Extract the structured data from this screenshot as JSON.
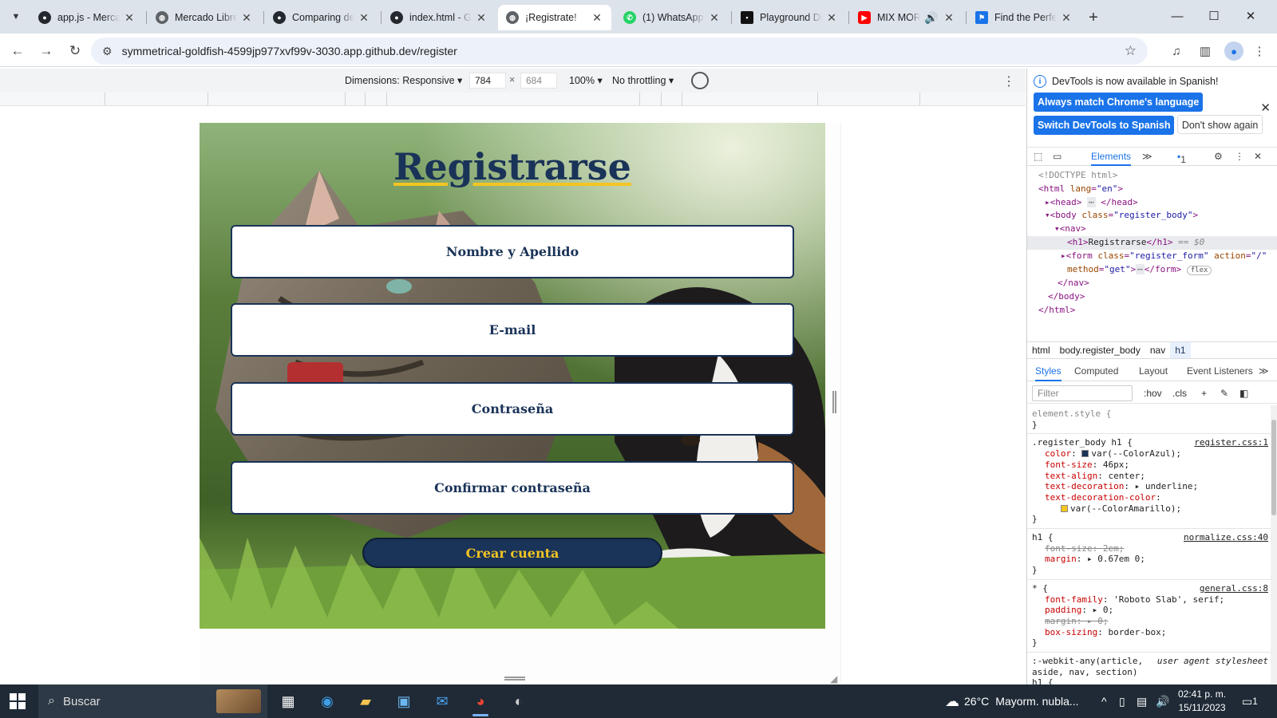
{
  "tabs": [
    {
      "title": "app.js - Mercado",
      "favicon": "github-icon",
      "active": false
    },
    {
      "title": "Mercado Libre",
      "favicon": "globe-icon",
      "active": false
    },
    {
      "title": "Comparing de",
      "favicon": "github-icon",
      "active": false
    },
    {
      "title": "index.html - G",
      "favicon": "github-icon",
      "active": false
    },
    {
      "title": "¡Registrate!",
      "favicon": "globe-icon",
      "active": true
    },
    {
      "title": "(1) WhatsApp",
      "favicon": "whatsapp-icon",
      "active": false
    },
    {
      "title": "Playground Di",
      "favicon": "playground-icon",
      "active": false
    },
    {
      "title": "MIX MORA",
      "favicon": "youtube-icon",
      "active": false
    },
    {
      "title": "Find the Perfe",
      "favicon": "flag-icon",
      "active": false
    }
  ],
  "address": {
    "url": "symmetrical-goldfish-4599jp977xvf99v-3030.app.github.dev/register"
  },
  "device_toolbar": {
    "dimensions": "Dimensions: Responsive",
    "width": "784",
    "height": "684",
    "zoom": "100%",
    "throttling": "No throttling"
  },
  "page": {
    "title": "Registrarse",
    "fields": [
      "Nombre y Apellido",
      "E-mail",
      "Contraseña",
      "Confirmar contraseña"
    ],
    "submit": "Crear cuenta"
  },
  "devtools": {
    "info_message": "DevTools is now available in Spanish!",
    "btn_match": "Always match Chrome's language",
    "btn_switch": "Switch DevTools to Spanish",
    "btn_dont_show": "Don't show again",
    "tab_elements": "Elements",
    "issues_count": "1",
    "dom": {
      "doctype": "<!DOCTYPE html>",
      "html_open": "<html ",
      "html_lang_attr": "lang",
      "html_lang_val": "\"en\"",
      "head": "<head>",
      "head_close": "</head>",
      "body_open": "<body ",
      "body_class_attr": "class",
      "body_class_val": "\"register_body\"",
      "nav_open": "<nav>",
      "h1_text": "Registrarse",
      "h1_hint": "== $0",
      "form_open": "<form ",
      "form_class_attr": "class",
      "form_class_val": "\"register_form\"",
      "form_action_attr": "action",
      "form_action_val": "\"/\"",
      "form_method_attr": "method",
      "form_method_val": "\"get\"",
      "form_close": "</form>",
      "flex_badge": "flex",
      "nav_close": "</nav>",
      "body_close": "</body>",
      "html_close": "</html>"
    },
    "breadcrumbs": [
      "html",
      "body.register_body",
      "nav",
      "h1"
    ],
    "subtabs": [
      "Styles",
      "Computed",
      "Layout",
      "Event Listeners"
    ],
    "filter_placeholder": "Filter",
    "hov": ":hov",
    "cls": ".cls",
    "styles": {
      "element_style": "element.style {",
      "rule1_selector": ".register_body h1 {",
      "rule1_source": "register.css:1",
      "rule1_props": [
        {
          "name": "color",
          "value": "var(--ColorAzul);",
          "swatch": "#1a3358"
        },
        {
          "name": "font-size",
          "value": "46px;"
        },
        {
          "name": "text-align",
          "value": "center;"
        },
        {
          "name": "text-decoration",
          "value": "▸ underline;"
        },
        {
          "name": "text-decoration-color",
          "value": ""
        },
        {
          "name": "",
          "value": "var(--ColorAmarillo);",
          "swatch": "#f3c522"
        }
      ],
      "rule2_selector": "h1 {",
      "rule2_source": "normalize.css:40",
      "rule2_props": [
        {
          "name": "font-size",
          "value": "2em;",
          "struck": true
        },
        {
          "name": "margin",
          "value": "▸ 0.67em 0;"
        }
      ],
      "rule3_selector": "* {",
      "rule3_source": "general.css:8",
      "rule3_props": [
        {
          "name": "font-family",
          "value": "'Roboto Slab', serif;"
        },
        {
          "name": "padding",
          "value": "▸ 0;"
        },
        {
          "name": "margin",
          "value": "▸ 0;",
          "struck": true
        },
        {
          "name": "box-sizing",
          "value": "border-box;"
        }
      ],
      "ua_selector": ":-webkit-any(article, aside, nav, section) h1 {",
      "ua_source": "user agent stylesheet"
    }
  },
  "taskbar": {
    "search_placeholder": "Buscar",
    "temperature": "26°C",
    "weather": "Mayorm. nubla...",
    "time": "02:41 p. m.",
    "date": "15/11/2023",
    "notifications": "1"
  },
  "colors": {
    "brand_blue": "#1a3358",
    "brand_yellow": "#f3c522",
    "chrome_blue": "#1a73e8"
  }
}
